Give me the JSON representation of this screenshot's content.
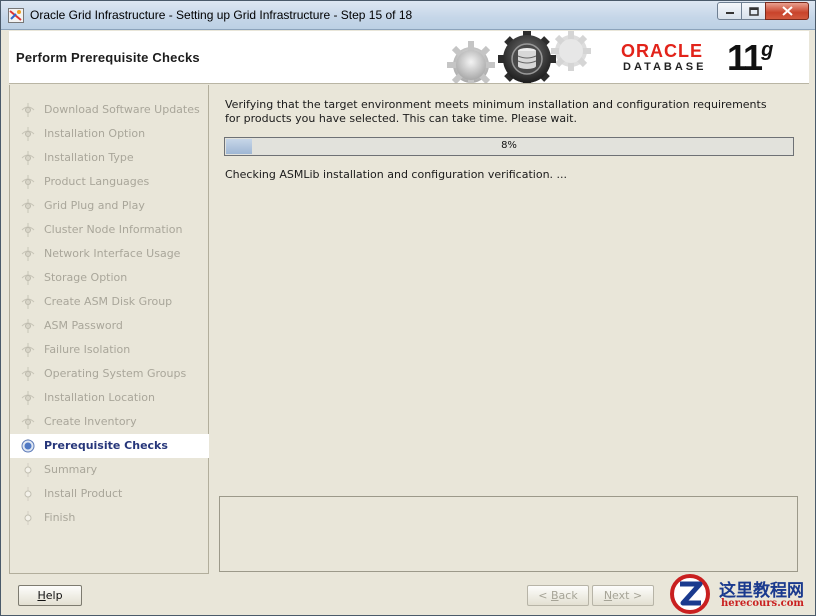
{
  "window": {
    "title": "Oracle Grid Infrastructure - Setting up Grid Infrastructure - Step 15 of 18"
  },
  "header": {
    "page_title": "Perform Prerequisite Checks",
    "logo_oracle": "ORACLE",
    "logo_database": "DATABASE",
    "logo_version_number": "11",
    "logo_version_letter": "g"
  },
  "steps": [
    {
      "label": "Download Software Updates",
      "state": "done"
    },
    {
      "label": "Installation Option",
      "state": "done"
    },
    {
      "label": "Installation Type",
      "state": "done"
    },
    {
      "label": "Product Languages",
      "state": "done"
    },
    {
      "label": "Grid Plug and Play",
      "state": "done"
    },
    {
      "label": "Cluster Node Information",
      "state": "done"
    },
    {
      "label": "Network Interface Usage",
      "state": "done"
    },
    {
      "label": "Storage Option",
      "state": "done"
    },
    {
      "label": "Create ASM Disk Group",
      "state": "done"
    },
    {
      "label": "ASM Password",
      "state": "done"
    },
    {
      "label": "Failure Isolation",
      "state": "done"
    },
    {
      "label": "Operating System Groups",
      "state": "done"
    },
    {
      "label": "Installation Location",
      "state": "done"
    },
    {
      "label": "Create Inventory",
      "state": "done"
    },
    {
      "label": "Prerequisite Checks",
      "state": "current"
    },
    {
      "label": "Summary",
      "state": "pending"
    },
    {
      "label": "Install Product",
      "state": "pending"
    },
    {
      "label": "Finish",
      "state": "pending"
    }
  ],
  "content": {
    "description": "Verifying that the target environment meets minimum installation and configuration requirements for products you have selected. This can take time. Please wait.",
    "progress_value": 0.08,
    "progress_text": "8%",
    "status_text": "Checking ASMLib installation and configuration verification. ..."
  },
  "buttons": {
    "help_label": "Help",
    "back_label": "< Back",
    "next_label": "Next >"
  },
  "watermark": {
    "cn": "这里教程网",
    "en": "herecours.com"
  },
  "colors": {
    "oracle_red": "#e2231a",
    "current_step": "#26367a",
    "progress_fill": "#9fb7d4"
  }
}
